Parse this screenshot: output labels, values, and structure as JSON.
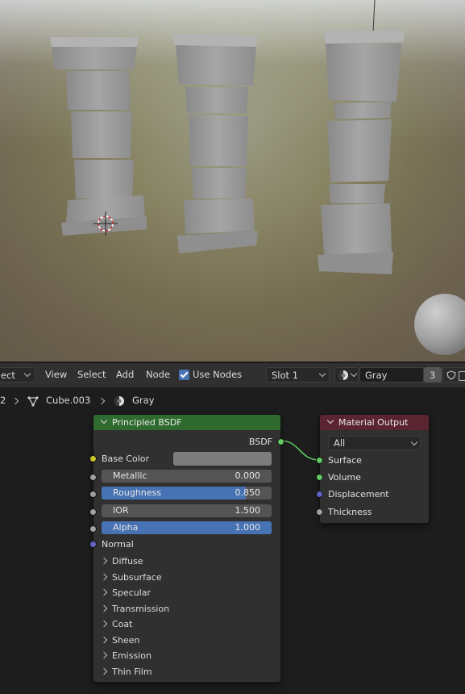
{
  "viewport": {
    "objects": [
      "pillar-left",
      "pillar-middle",
      "pillar-right",
      "preview-sphere"
    ]
  },
  "header": {
    "mode_label": "ect",
    "menu": [
      "View",
      "Select",
      "Add",
      "Node"
    ],
    "use_nodes_label": "Use Nodes",
    "use_nodes_checked": true,
    "slot_label": "Slot 1",
    "material_name": "Gray",
    "user_count": "3"
  },
  "breadcrumb": {
    "left_fragment": "2",
    "object": "Cube.003",
    "material": "Gray"
  },
  "principled": {
    "title": "Principled BSDF",
    "header_color": "#2f6b2f",
    "output_label": "BSDF",
    "base_color_label": "Base Color",
    "base_color_value": "#7d7d7d",
    "fields": [
      {
        "label": "Metallic",
        "value": "0.000",
        "fraction": 0.0
      },
      {
        "label": "Roughness",
        "value": "0.850",
        "fraction": 0.85
      },
      {
        "label": "IOR",
        "value": "1.500",
        "fraction": 0.0
      },
      {
        "label": "Alpha",
        "value": "1.000",
        "fraction": 1.0
      }
    ],
    "normal_label": "Normal",
    "panels": [
      "Diffuse",
      "Subsurface",
      "Specular",
      "Transmission",
      "Coat",
      "Sheen",
      "Emission",
      "Thin Film"
    ]
  },
  "material_output": {
    "title": "Material Output",
    "header_color": "#5a2530",
    "target": "All",
    "inputs": [
      "Surface",
      "Volume",
      "Displacement",
      "Thickness"
    ]
  },
  "colors": {
    "accent": "#4772b3",
    "socket_shader": "#63c763",
    "socket_float": "#a1a1a1",
    "socket_color": "#c7c729",
    "socket_vector": "#6363c7"
  }
}
